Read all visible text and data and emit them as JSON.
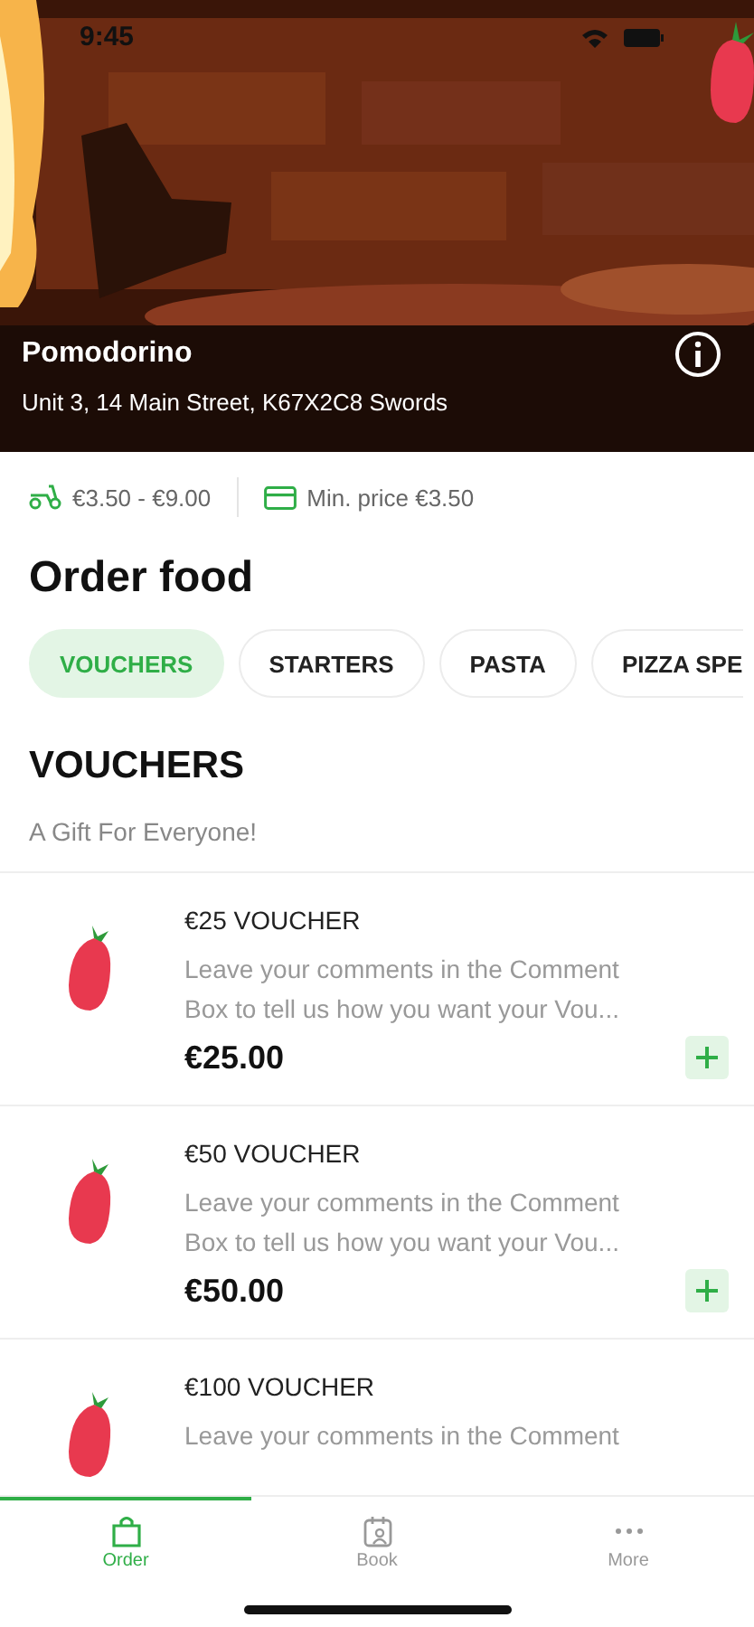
{
  "status_bar": {
    "time": "9:45"
  },
  "hero": {
    "name": "Pomodorino",
    "address": "Unit 3, 14 Main Street, K67X2C8 Swords"
  },
  "info": {
    "delivery_fee": "€3.50 - €9.00",
    "min_price": "Min. price €3.50"
  },
  "title": "Order food",
  "categories": [
    {
      "label": "VOUCHERS",
      "selected": true
    },
    {
      "label": "STARTERS",
      "selected": false
    },
    {
      "label": "PASTA",
      "selected": false
    },
    {
      "label": "PIZZA SPE",
      "selected": false
    }
  ],
  "section": {
    "title": "VOUCHERS",
    "subtitle": "A Gift For Everyone!"
  },
  "items": [
    {
      "name": "€25 VOUCHER",
      "description": "Leave your comments in the Comment Box to tell us how you want your Vou...",
      "price": "€25.00"
    },
    {
      "name": "€50 VOUCHER",
      "description": "Leave your comments in the Comment Box to tell us how you want your Vou...",
      "price": "€50.00"
    },
    {
      "name": "€100 VOUCHER",
      "description": "Leave your comments in the Comment"
    }
  ],
  "tabs": [
    {
      "label": "Order",
      "kind": "bag",
      "selected": true
    },
    {
      "label": "Book",
      "kind": "calendar",
      "selected": false
    },
    {
      "label": "More",
      "kind": "dots",
      "selected": false
    }
  ]
}
